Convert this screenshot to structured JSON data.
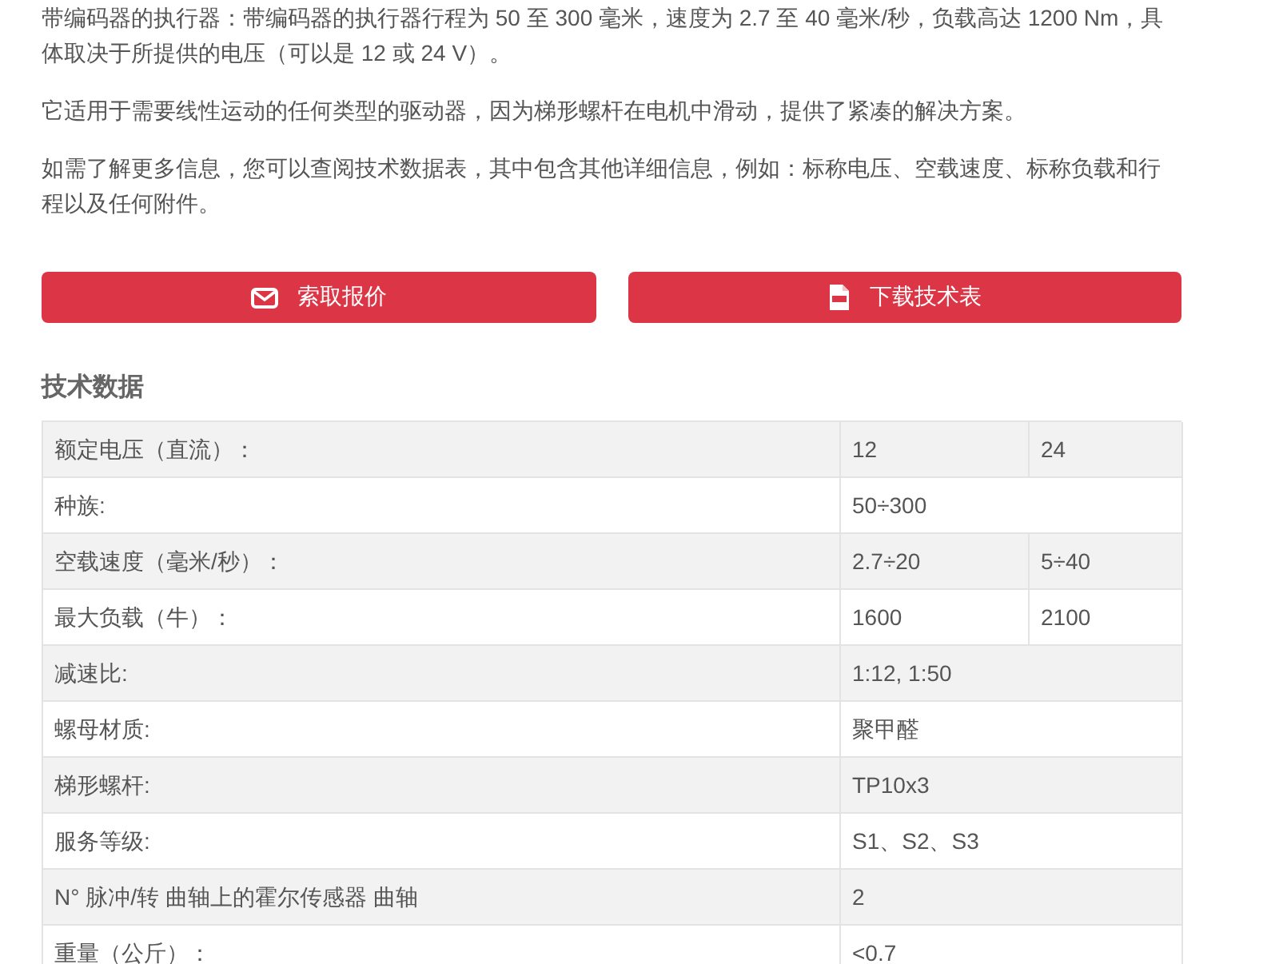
{
  "paragraphs": [
    "带编码器的执行器：带编码器的执行器行程为 50 至 300 毫米，速度为 2.7 至 40 毫米/秒，负载高达 1200 Nm，具体取决于所提供的电压（可以是 12 或 24 V）。",
    "它适用于需要线性运动的任何类型的驱动器，因为梯形螺杆在电机中滑动，提供了紧凑的解决方案。",
    "如需了解更多信息，您可以查阅技术数据表，其中包含其他详细信息，例如：标称电压、空载速度、标称负载和行程以及任何附件。"
  ],
  "buttons": [
    {
      "kind": "mail",
      "label": "索取报价"
    },
    {
      "kind": "pdf",
      "label": "下载技术表"
    }
  ],
  "section_title": "技术数据",
  "table": {
    "rows": [
      {
        "label": "额定电压（直流）：",
        "values": [
          "12",
          "24"
        ]
      },
      {
        "label": "种族:",
        "values": [
          "50÷300"
        ]
      },
      {
        "label": "空载速度（毫米/秒）：",
        "values": [
          "2.7÷20",
          "5÷40"
        ]
      },
      {
        "label": "最大负载（牛）：",
        "values": [
          "1600",
          "2100"
        ]
      },
      {
        "label": "减速比:",
        "values": [
          "1:12, 1:50"
        ]
      },
      {
        "label": "螺母材质:",
        "values": [
          "聚甲醛"
        ]
      },
      {
        "label": "梯形螺杆:",
        "values": [
          "TP10x3"
        ]
      },
      {
        "label": "服务等级:",
        "values": [
          "S1、S2、S3"
        ]
      },
      {
        "label": "N° 脉冲/转 曲轴上的霍尔传感器 曲轴",
        "values": [
          "2"
        ]
      },
      {
        "label": "重量（公斤）：",
        "values": [
          "<0.7"
        ]
      }
    ]
  }
}
